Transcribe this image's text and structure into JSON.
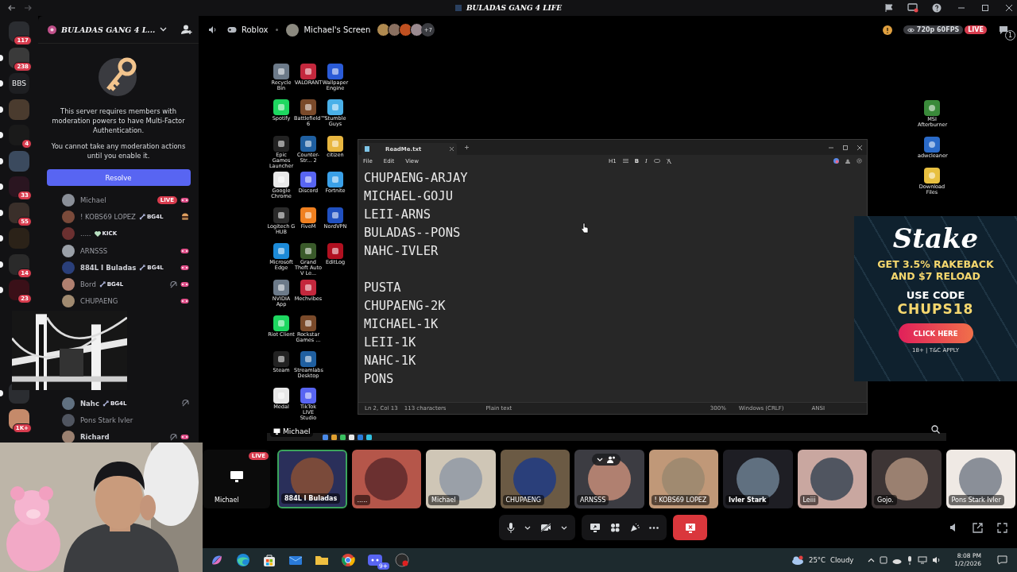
{
  "titlebar": {
    "title": "BULADAS GANG 4 LIFE"
  },
  "servers": [
    {
      "color": "#2b2d31",
      "badge": "117",
      "unread": false
    },
    {
      "color": "#3a3a3a",
      "badge": "238",
      "unread": true
    },
    {
      "color": "#1e1f22",
      "label": "BBS",
      "unread": true
    },
    {
      "color": "#4a3b2e",
      "unread": true
    },
    {
      "color": "#1a1a1a",
      "badge": "4",
      "unread": true
    },
    {
      "color": "#3b4a5e",
      "unread": true
    },
    {
      "color": "#2a1520",
      "badge": "33",
      "unread": true
    },
    {
      "color": "#3a2f2a",
      "badge": "55",
      "unread": true
    },
    {
      "color": "#2b2218",
      "unread": true
    },
    {
      "color": "#2a2a2a",
      "badge": "14",
      "unread": true
    },
    {
      "color": "#3a1018",
      "badge": "23",
      "unread": true
    }
  ],
  "servers_lower": [
    {
      "color": "#2b2d31",
      "unread": true
    },
    {
      "color": "#c58a6a",
      "badge": "1K+",
      "unread": false
    }
  ],
  "server": {
    "name": "BULADAS GANG 4 L...",
    "notice": {
      "message": "This server requires members with moderation powers to have Multi-Factor Authentication.",
      "detail": "You cannot take any moderation actions until you enable it.",
      "button": "Resolve"
    }
  },
  "members": [
    {
      "name": "Michael",
      "live": "LIVE",
      "activity": {
        "kind": "game"
      },
      "deafened": false,
      "bold": false
    },
    {
      "name": "! KOBS69 LOPEZ",
      "tag": {
        "label": "BG4L",
        "kind": "role"
      },
      "activity": {
        "kind": "food"
      },
      "deafened": false,
      "bold": false
    },
    {
      "name": ".....",
      "tag": {
        "label": "KICK",
        "kind": "heart"
      },
      "deafened": false,
      "bold": false
    },
    {
      "name": "ARNSSS",
      "activity": {
        "kind": "game"
      },
      "deafened": false,
      "bold": false
    },
    {
      "name": "884L I Buladas",
      "tag": {
        "label": "BG4L",
        "kind": "role"
      },
      "activity": {
        "kind": "game"
      },
      "deafened": false,
      "bold": true
    },
    {
      "name": "Bord",
      "tag": {
        "label": "BG4L",
        "kind": "role"
      },
      "activity": {
        "kind": "game"
      },
      "deafened": true,
      "bold": false
    },
    {
      "name": "CHUPAENG",
      "activity": {
        "kind": "game"
      },
      "deafened": false,
      "bold": false
    }
  ],
  "members_lower": [
    {
      "name": "Nahc",
      "tag": {
        "label": "BG4L",
        "kind": "role"
      },
      "deafened": true,
      "bold": true
    },
    {
      "name": "Pons Stark Ivler",
      "deafened": false,
      "bold": false
    },
    {
      "name": "Richard",
      "activity": {
        "kind": "game"
      },
      "deafened": true,
      "bold": true
    }
  ],
  "stream": {
    "game": "Roblox",
    "screen": "Michael's Screen",
    "more_viewers": "+7",
    "quality": "720p 60FPS",
    "live": "LIVE",
    "chat_badge": "1",
    "label": "Michael"
  },
  "desktop_icons": [
    [
      "Recycle Bin",
      "VALORANT",
      "Wallpaper Engine"
    ],
    [
      "Spotify",
      "Battlefield™ 6",
      "Stumble Guys"
    ],
    [
      "Epic Games Launcher",
      "Counter-Str... 2",
      "citizen"
    ],
    [
      "Google Chrome",
      "Discord",
      "Fortnite"
    ],
    [
      "Logitech G HUB",
      "FiveM",
      "NordVPN"
    ],
    [
      "Microsoft Edge",
      "Grand Theft Auto V Le...",
      "EditLog"
    ],
    [
      "NVIDIA App",
      "Mechvibes"
    ],
    [
      "Riot Client",
      "Rockstar Games ..."
    ],
    [
      "Steam",
      "Streamlabs Desktop"
    ],
    [
      "Medal",
      "TikTok LIVE Studio"
    ]
  ],
  "desktop_icons_right": [
    "MSI Afterburner",
    "adwcleaner",
    "Download Files"
  ],
  "notepad": {
    "tab": "ReadMe.txt",
    "menu": [
      "File",
      "Edit",
      "View"
    ],
    "format": {
      "heading": "H1",
      "bold": "B",
      "italic": "I"
    },
    "paragraphs": [
      [
        "CHUPAENG-ARJAY",
        "MICHAEL-GOJU",
        "LEII-ARNS",
        "BULADAS--PONS",
        "NAHC-IVLER"
      ],
      [
        "PUSTA",
        "CHUPAENG-2K",
        "MICHAEL-1K",
        "LEII-1K",
        "NAHC-1K",
        "PONS"
      ]
    ],
    "status": [
      "Ln 2, Col 13",
      "113 characters",
      "Plain text",
      "300%",
      "Windows (CRLF)",
      "ANSI"
    ]
  },
  "ad": {
    "logo": "Stake",
    "headline": [
      "GET 3.5% RAKEBACK",
      "AND $7 RELOAD"
    ],
    "code_label": "USE CODE",
    "code": "CHUPS18",
    "button": "CLICK HERE",
    "terms": "18+ | T&C APPLY"
  },
  "tiles": [
    {
      "kind": "screen",
      "name": "Michael",
      "live": "LIVE",
      "speaking": false,
      "hovered": false,
      "bold": false,
      "color": "#0b0b0b"
    },
    {
      "kind": "user",
      "name": "884L I Buladas",
      "speaking": true,
      "hovered": false,
      "bold": true,
      "color": "#2a2f5a"
    },
    {
      "kind": "user",
      "name": ".....",
      "speaking": false,
      "hovered": false,
      "bold": false,
      "color": "#b5564a"
    },
    {
      "kind": "user",
      "name": "Michael",
      "speaking": false,
      "hovered": false,
      "bold": false,
      "color": "#cfc6b6"
    },
    {
      "kind": "user",
      "name": "CHUPAENG",
      "speaking": false,
      "hovered": false,
      "bold": false,
      "color": "#6b5a44"
    },
    {
      "kind": "user",
      "name": "ARNSSS",
      "speaking": false,
      "hovered": true,
      "bold": false,
      "color": "#3c3c42"
    },
    {
      "kind": "user",
      "name": "! KOBS69 LOPEZ",
      "speaking": false,
      "hovered": false,
      "bold": false,
      "color": "#c09878"
    },
    {
      "kind": "user",
      "name": "Ivler Stark",
      "speaking": false,
      "hovered": false,
      "bold": true,
      "color": "#1e1e24"
    },
    {
      "kind": "user",
      "name": "Leiii",
      "speaking": false,
      "hovered": false,
      "bold": false,
      "color": "#c9a7a0"
    },
    {
      "kind": "user",
      "name": "Gojo.",
      "speaking": false,
      "hovered": false,
      "bold": false,
      "color": "#3d3535"
    },
    {
      "kind": "user",
      "name": "Pons Stark Ivler",
      "speaking": false,
      "hovered": false,
      "bold": false,
      "color": "#efe9e4"
    }
  ],
  "taskbar": {
    "discord_badge": "9+",
    "temperature": "25°C",
    "weather": "Cloudy",
    "time": "8:08 PM",
    "date": "1/2/2026"
  }
}
